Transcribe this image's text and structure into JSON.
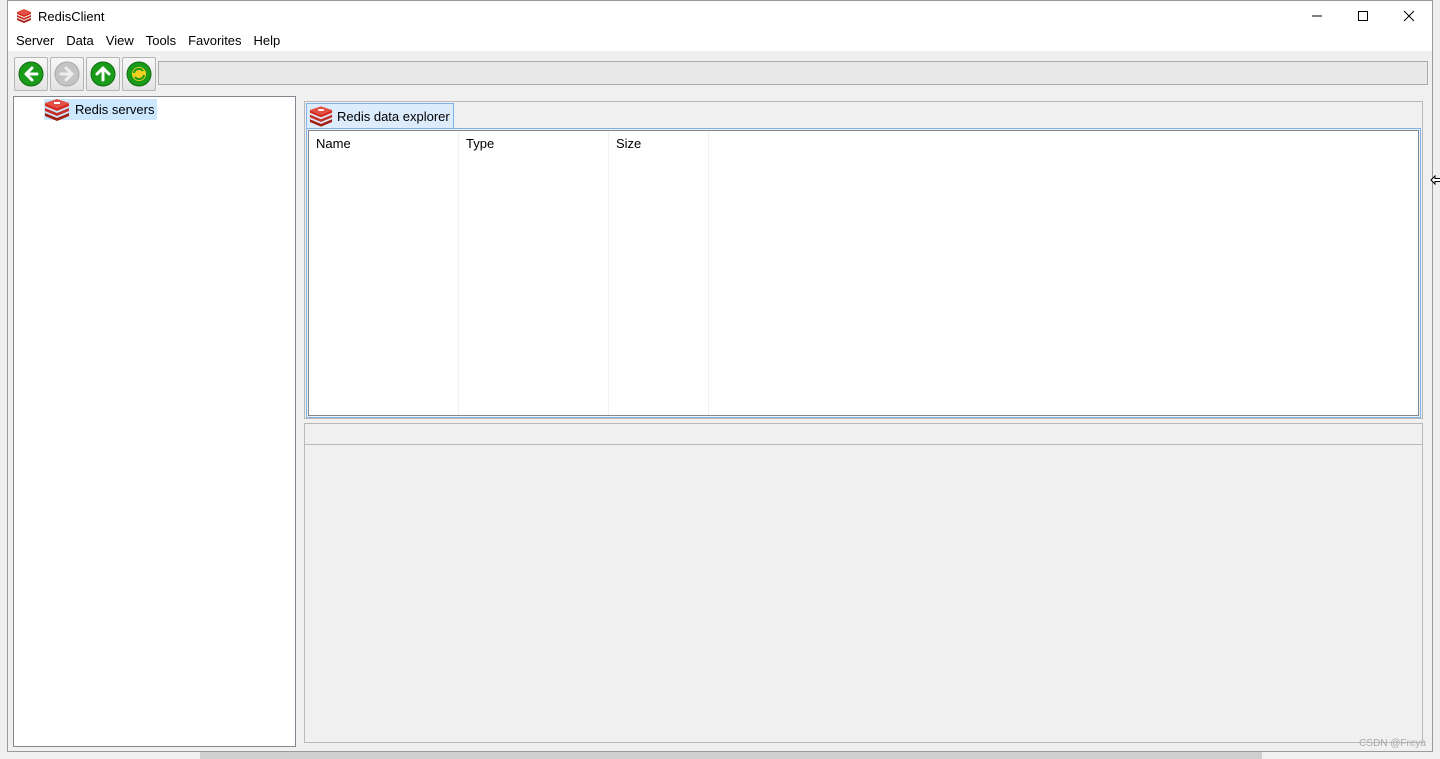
{
  "window": {
    "title": "RedisClient"
  },
  "menubar": {
    "items": [
      "Server",
      "Data",
      "View",
      "Tools",
      "Favorites",
      "Help"
    ]
  },
  "toolbar": {
    "buttons": [
      {
        "name": "back",
        "icon": "arrow-left-icon",
        "enabled": true
      },
      {
        "name": "forward",
        "icon": "arrow-right-icon",
        "enabled": false
      },
      {
        "name": "up",
        "icon": "arrow-up-icon",
        "enabled": true
      },
      {
        "name": "refresh",
        "icon": "refresh-icon",
        "enabled": true
      }
    ],
    "address_value": ""
  },
  "tree": {
    "items": [
      {
        "label": "Redis servers",
        "icon": "redis-icon",
        "selected": true
      }
    ]
  },
  "explorer": {
    "tab_label": "Redis data explorer",
    "columns": [
      "Name",
      "Type",
      "Size"
    ],
    "rows": []
  },
  "watermark": "CSDN @Freya",
  "colors": {
    "accent": "#7eb4ea",
    "selection": "#cce8ff",
    "redis_red": "#d82c20",
    "toolbar_green": "#1a9b1a"
  }
}
